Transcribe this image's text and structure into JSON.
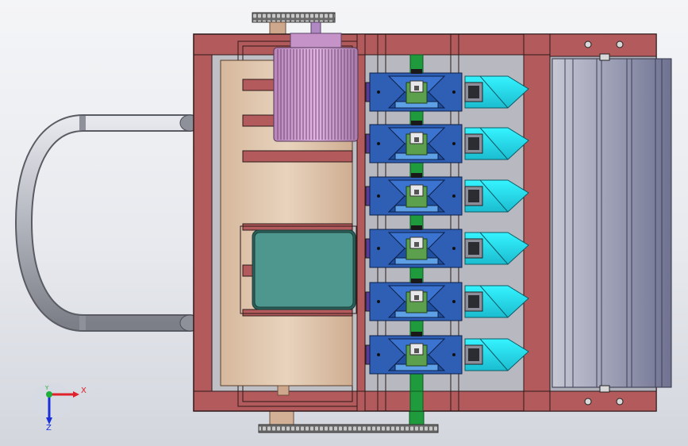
{
  "view": {
    "triad": {
      "x_label": "X",
      "y_label": "Y",
      "z_label": "Z",
      "x_color": "#e0202a",
      "y_color": "#1fae3a",
      "z_color": "#1a2fd8"
    }
  },
  "colors": {
    "frame": "#b35a5c",
    "frame_edge": "#3a2020",
    "frame_inner": "#c9a79a",
    "handle": "#b9bbc4",
    "motor": "#d6a0d8",
    "reducer": "#4d978f",
    "seed_box": "#2f5fb5",
    "seed_cup": "#5c9f4c",
    "shaft": "#1f9a3c",
    "spout": "#20e0f0",
    "press_roller": "#8c8fa8"
  }
}
